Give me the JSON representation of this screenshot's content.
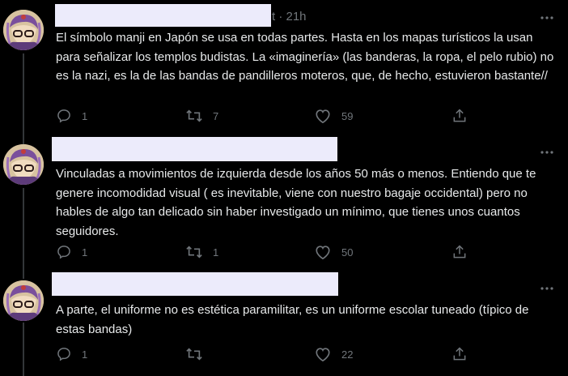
{
  "theme": {
    "background": "#000000",
    "text": "#e7e9ea",
    "muted": "#71767b",
    "redaction": "#ecebfb",
    "thread_line": "#333639"
  },
  "tweets": [
    {
      "meta": "t · 21h",
      "text": "El símbolo manji en Japón se usa en todas partes. Hasta en los mapas turísticos la usan para señalizar los templos budistas. La «imaginería» (las banderas, la ropa, el pelo rubio) no es la nazi, es la de las bandas de pandilleros moteros, que, de hecho, estuvieron bastante//",
      "replies": "1",
      "retweets": "7",
      "likes": "59",
      "icons": [
        "reply-icon",
        "retweet-icon",
        "like-icon",
        "share-icon",
        "more-icon"
      ]
    },
    {
      "meta": "",
      "text": "Vinculadas a movimientos de izquierda desde los años 50 más o menos. Entiendo que te genere incomodidad visual ( es inevitable, viene con nuestro bagaje occidental) pero no hables de algo tan delicado sin haber investigado un mínimo, que tienes unos cuantos seguidores.",
      "replies": "1",
      "retweets": "1",
      "likes": "50"
    },
    {
      "meta": "",
      "text": "A parte, el uniforme no es estética paramilitar, es un uniforme escolar tuneado (típico de estas bandas)",
      "replies": "1",
      "retweets": "",
      "likes": "22"
    }
  ]
}
